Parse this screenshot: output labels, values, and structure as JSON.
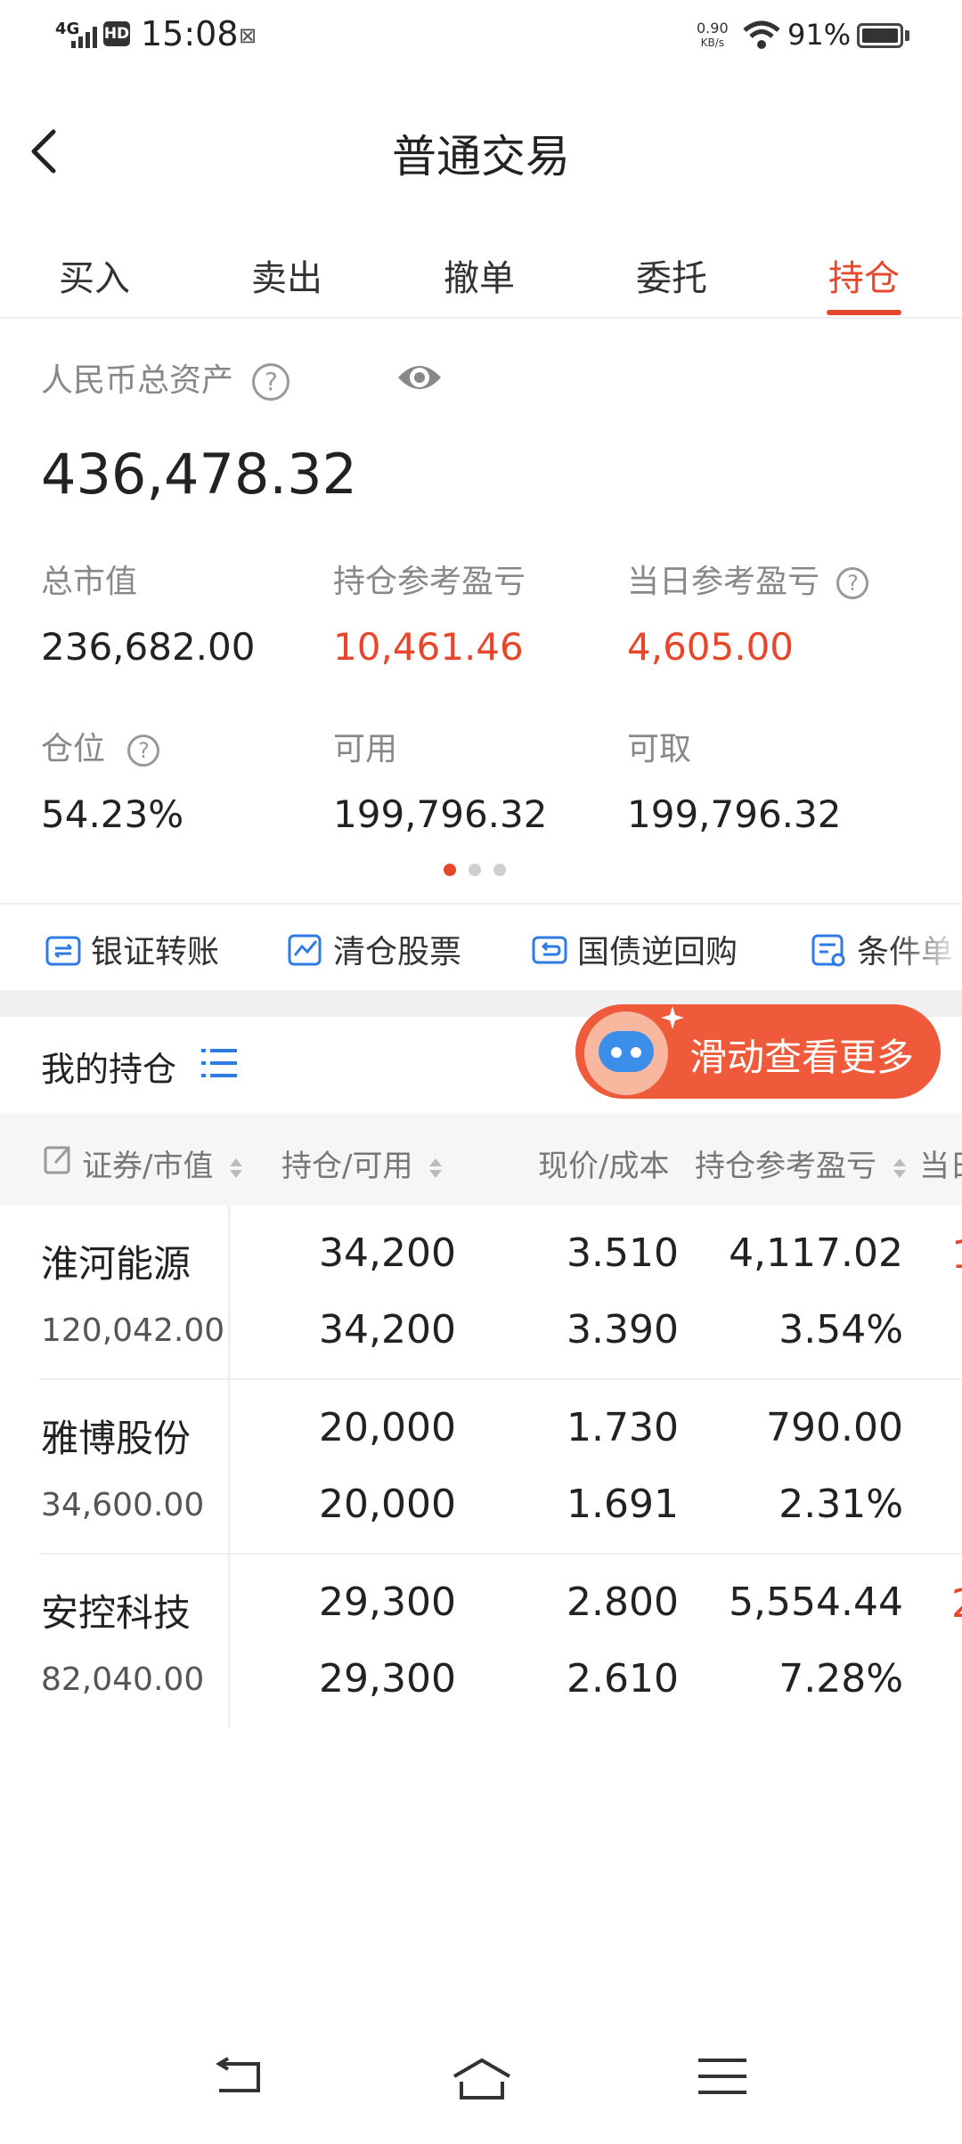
{
  "status": {
    "signal": "4G",
    "hd": "HD",
    "time": "15:08",
    "net_speed_value": "0.90",
    "net_speed_unit": "KB/s",
    "battery": "91%"
  },
  "header": {
    "title": "普通交易"
  },
  "tabs": [
    {
      "label": "买入"
    },
    {
      "label": "卖出"
    },
    {
      "label": "撤单"
    },
    {
      "label": "委托"
    },
    {
      "label": "持仓"
    }
  ],
  "active_tab": "持仓",
  "assets": {
    "total_label": "人民币总资产",
    "total_value": "436,478.32",
    "market_value_label": "总市值",
    "market_value": "236,682.00",
    "position_pnl_label": "持仓参考盈亏",
    "position_pnl": "10,461.46",
    "daily_pnl_label": "当日参考盈亏",
    "daily_pnl": "4,605.00",
    "position_ratio_label": "仓位",
    "position_ratio": "54.23%",
    "available_label": "可用",
    "available": "199,796.32",
    "withdrawable_label": "可取",
    "withdrawable": "199,796.32"
  },
  "quick_actions": [
    {
      "label": "银证转账",
      "icon": "transfer-icon"
    },
    {
      "label": "清仓股票",
      "icon": "clear-stock-icon"
    },
    {
      "label": "国债逆回购",
      "icon": "reverse-repo-icon"
    },
    {
      "label": "条件单",
      "icon": "conditional-order-icon"
    }
  ],
  "holdings": {
    "title": "我的持仓",
    "scroll_hint": "滑动查看更多",
    "columns": [
      "证券/市值",
      "持仓/可用",
      "现价/成本",
      "持仓参考盈亏",
      "当日"
    ],
    "rows": [
      {
        "name": "淮河能源",
        "market_value": "120,042.00",
        "holding": "34,200",
        "available": "34,200",
        "price": "3.510",
        "cost": "3.390",
        "pnl": "4,117.02",
        "pnl_pct": "3.54%"
      },
      {
        "name": "雅博股份",
        "market_value": "34,600.00",
        "holding": "20,000",
        "available": "20,000",
        "price": "1.730",
        "cost": "1.691",
        "pnl": "790.00",
        "pnl_pct": "2.31%"
      },
      {
        "name": "安控科技",
        "market_value": "82,040.00",
        "holding": "29,300",
        "available": "29,300",
        "price": "2.800",
        "cost": "2.610",
        "pnl": "5,554.44",
        "pnl_pct": "7.28%"
      }
    ]
  },
  "colors": {
    "accent": "#e8462b",
    "link_blue": "#2f7be6"
  }
}
